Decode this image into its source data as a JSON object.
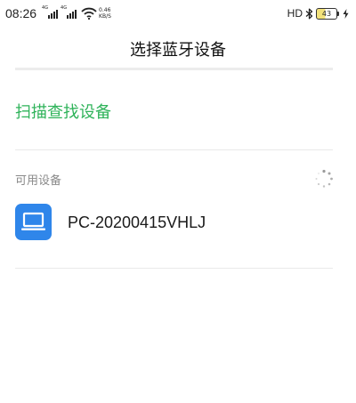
{
  "status_bar": {
    "time": "08:26",
    "sim1_tag": "4G",
    "sim2_tag": "4G",
    "net_speed_value": "0.46",
    "net_speed_unit": "KB/S",
    "hd_label": "HD",
    "battery_level": "43",
    "icons": [
      "signal-icon",
      "wifi-icon",
      "bluetooth-icon",
      "battery-icon",
      "charging-icon"
    ]
  },
  "header": {
    "title": "选择蓝牙设备"
  },
  "scan": {
    "label": "扫描查找设备",
    "color": "#2fb35a"
  },
  "available": {
    "section_label": "可用设备",
    "loading_icon": "spinner-icon",
    "devices": [
      {
        "name": "PC-20200415VHLJ",
        "icon": "laptop-icon",
        "icon_color": "#2f86ea"
      }
    ]
  }
}
